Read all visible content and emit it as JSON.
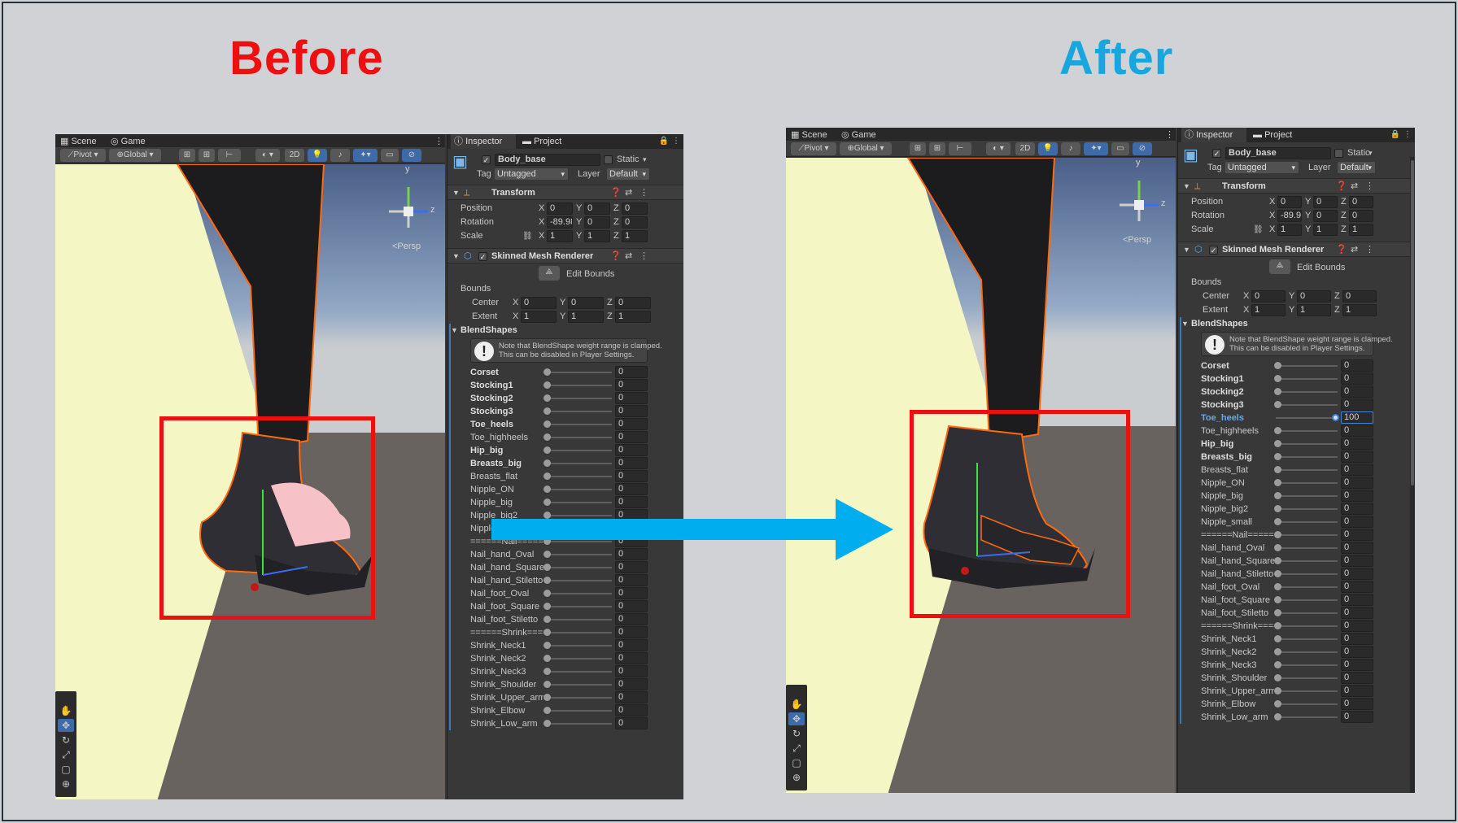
{
  "titles": {
    "before": "Before",
    "after": "After"
  },
  "colors": {
    "before": "#ee1010",
    "after": "#17a6dd",
    "arrow": "#00aeef",
    "highlight_box": "#ee1010",
    "accent": "#3d6aa8"
  },
  "scene_view": {
    "tabs": [
      "Scene",
      "Game"
    ],
    "toolbar": {
      "pivot": "Pivot",
      "global": "Global",
      "mode_2d": "2D"
    },
    "gizmo_label": "<Persp",
    "axis_labels": {
      "y": "y",
      "z": "z"
    },
    "tool_icons": [
      "hand-icon",
      "move-icon",
      "rotate-icon",
      "scale-icon",
      "rect-icon",
      "transform-icon"
    ]
  },
  "inspector_tabs": [
    "Inspector",
    "Project"
  ],
  "object": {
    "name": "Body_base",
    "static_label": "Static",
    "tag_label": "Tag",
    "tag_value": "Untagged",
    "layer_label": "Layer",
    "layer_value": "Default"
  },
  "transform": {
    "title": "Transform",
    "position": {
      "label": "Position",
      "x": "0",
      "y": "0",
      "z": "0"
    },
    "rotation": {
      "label": "Rotation",
      "x": "-89.98",
      "y": "0",
      "z": "0"
    },
    "scale": {
      "label": "Scale",
      "x": "1",
      "y": "1",
      "z": "1"
    }
  },
  "smr": {
    "title": "Skinned Mesh Renderer",
    "edit_bounds": "Edit Bounds",
    "bounds_label": "Bounds",
    "center": {
      "label": "Center",
      "x": "0",
      "y": "0",
      "z": "0"
    },
    "extent": {
      "label": "Extent",
      "x": "1",
      "y": "1",
      "z": "1"
    },
    "blendshapes_label": "BlendShapes",
    "note_line1": "Note that BlendShape weight range is clamped.",
    "note_line2": "This can be disabled in Player Settings."
  },
  "axis_letters": {
    "x": "X",
    "y": "Y",
    "z": "Z"
  },
  "blendshapes_before": [
    {
      "name": "Corset",
      "value": "0",
      "bold": true
    },
    {
      "name": "Stocking1",
      "value": "0",
      "bold": true
    },
    {
      "name": "Stocking2",
      "value": "0",
      "bold": true
    },
    {
      "name": "Stocking3",
      "value": "0",
      "bold": true
    },
    {
      "name": "Toe_heels",
      "value": "0",
      "bold": true
    },
    {
      "name": "Toe_highheels",
      "value": "0",
      "bold": false
    },
    {
      "name": "Hip_big",
      "value": "0",
      "bold": true
    },
    {
      "name": "Breasts_big",
      "value": "0",
      "bold": true
    },
    {
      "name": "Breasts_flat",
      "value": "0",
      "bold": false
    },
    {
      "name": "Nipple_ON",
      "value": "0",
      "bold": false
    },
    {
      "name": "Nipple_big",
      "value": "0",
      "bold": false
    },
    {
      "name": "Nipple_big2",
      "value": "0",
      "bold": false
    },
    {
      "name": "Nipple_small",
      "value": "0",
      "bold": false
    },
    {
      "name": "======Nail=====",
      "value": "0",
      "bold": false
    },
    {
      "name": "Nail_hand_Oval",
      "value": "0",
      "bold": false
    },
    {
      "name": "Nail_hand_Square",
      "value": "0",
      "bold": false
    },
    {
      "name": "Nail_hand_Stiletto",
      "value": "0",
      "bold": false
    },
    {
      "name": "Nail_foot_Oval",
      "value": "0",
      "bold": false
    },
    {
      "name": "Nail_foot_Square",
      "value": "0",
      "bold": false
    },
    {
      "name": "Nail_foot_Stiletto",
      "value": "0",
      "bold": false
    },
    {
      "name": "======Shrink=====",
      "value": "0",
      "bold": false
    },
    {
      "name": "Shrink_Neck1",
      "value": "0",
      "bold": false
    },
    {
      "name": "Shrink_Neck2",
      "value": "0",
      "bold": false
    },
    {
      "name": "Shrink_Neck3",
      "value": "0",
      "bold": false
    },
    {
      "name": "Shrink_Shoulder",
      "value": "0",
      "bold": false
    },
    {
      "name": "Shrink_Upper_arm",
      "value": "0",
      "bold": false
    },
    {
      "name": "Shrink_Elbow",
      "value": "0",
      "bold": false
    },
    {
      "name": "Shrink_Low_arm",
      "value": "0",
      "bold": false
    }
  ],
  "blendshapes_after": [
    {
      "name": "Corset",
      "value": "0",
      "bold": true
    },
    {
      "name": "Stocking1",
      "value": "0",
      "bold": true
    },
    {
      "name": "Stocking2",
      "value": "0",
      "bold": true
    },
    {
      "name": "Stocking3",
      "value": "0",
      "bold": true
    },
    {
      "name": "Toe_heels",
      "value": "100",
      "bold": true,
      "active": true
    },
    {
      "name": "Toe_highheels",
      "value": "0",
      "bold": false
    },
    {
      "name": "Hip_big",
      "value": "0",
      "bold": true
    },
    {
      "name": "Breasts_big",
      "value": "0",
      "bold": true
    },
    {
      "name": "Breasts_flat",
      "value": "0",
      "bold": false
    },
    {
      "name": "Nipple_ON",
      "value": "0",
      "bold": false
    },
    {
      "name": "Nipple_big",
      "value": "0",
      "bold": false
    },
    {
      "name": "Nipple_big2",
      "value": "0",
      "bold": false
    },
    {
      "name": "Nipple_small",
      "value": "0",
      "bold": false
    },
    {
      "name": "======Nail=====",
      "value": "0",
      "bold": false
    },
    {
      "name": "Nail_hand_Oval",
      "value": "0",
      "bold": false
    },
    {
      "name": "Nail_hand_Square",
      "value": "0",
      "bold": false
    },
    {
      "name": "Nail_hand_Stiletto",
      "value": "0",
      "bold": false
    },
    {
      "name": "Nail_foot_Oval",
      "value": "0",
      "bold": false
    },
    {
      "name": "Nail_foot_Square",
      "value": "0",
      "bold": false
    },
    {
      "name": "Nail_foot_Stiletto",
      "value": "0",
      "bold": false
    },
    {
      "name": "======Shrink=====",
      "value": "0",
      "bold": false
    },
    {
      "name": "Shrink_Neck1",
      "value": "0",
      "bold": false
    },
    {
      "name": "Shrink_Neck2",
      "value": "0",
      "bold": false
    },
    {
      "name": "Shrink_Neck3",
      "value": "0",
      "bold": false
    },
    {
      "name": "Shrink_Shoulder",
      "value": "0",
      "bold": false
    },
    {
      "name": "Shrink_Upper_arm",
      "value": "0",
      "bold": false
    },
    {
      "name": "Shrink_Elbow",
      "value": "0",
      "bold": false
    },
    {
      "name": "Shrink_Low_arm",
      "value": "0",
      "bold": false
    }
  ],
  "toe_heels_weight_after": 100
}
